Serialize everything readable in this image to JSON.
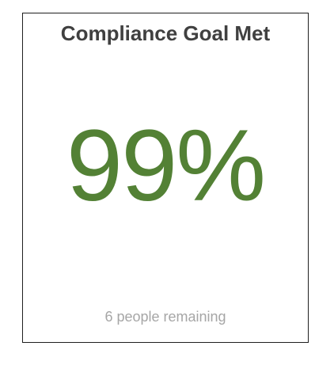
{
  "card": {
    "title": "Compliance Goal Met",
    "metric": "99%",
    "subtitle": "6 people remaining"
  },
  "colors": {
    "metric": "#538135",
    "title": "#404040",
    "subtitle": "#a6a6a6",
    "border": "#1f1f1f"
  }
}
